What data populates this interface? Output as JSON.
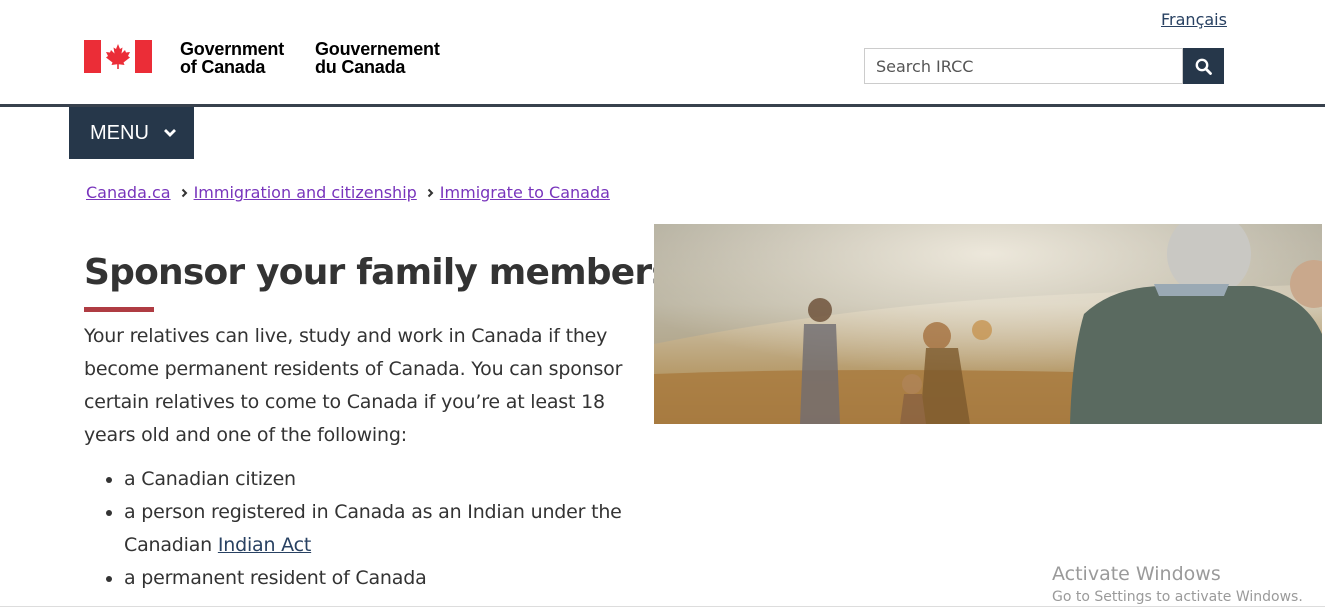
{
  "header": {
    "language_link": "Français",
    "gov_name_en_line1": "Government",
    "gov_name_en_line2": "of Canada",
    "gov_name_fr_line1": "Gouvernement",
    "gov_name_fr_line2": "du Canada",
    "search_placeholder": "Search IRCC",
    "search_icon": "search-icon"
  },
  "menu": {
    "label": "MENU",
    "icon": "chevron-down-icon"
  },
  "breadcrumb": [
    {
      "label": "Canada.ca"
    },
    {
      "label": "Immigration and citizenship"
    },
    {
      "label": "Immigrate to Canada"
    }
  ],
  "main": {
    "title": "Sponsor your family members",
    "intro": "Your relatives can live, study and work in Canada if they become permanent residents of Canada. You can sponsor certain relatives to come to Canada if you’re at least 18 years old and one of the following:",
    "list": {
      "item1": "a Canadian citizen",
      "item2_prefix": "a person registered in Canada as an Indian under the Canadian ",
      "item2_link": "Indian Act",
      "item3": "a permanent resident of Canada"
    }
  },
  "watermark": {
    "line1": "Activate Windows",
    "line2": "Go to Settings to activate Windows."
  },
  "colors": {
    "navy": "#26374a",
    "accent_red": "#af3c43",
    "flag_red": "#eb2d37",
    "visited_link": "#7834bc",
    "link": "#284162"
  }
}
